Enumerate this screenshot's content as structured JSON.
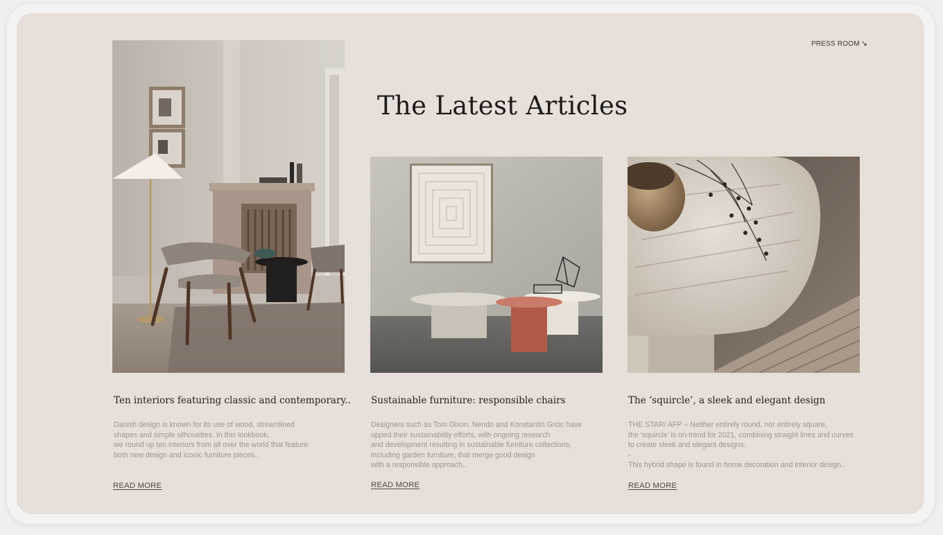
{
  "header": {
    "press_room": "PRESS ROOM",
    "press_room_icon": "arrow-down-right-icon"
  },
  "page_title": "The Latest Articles",
  "articles": [
    {
      "title": "Ten interiors featuring classic and contemporary..",
      "lines": [
        "Danish design is known for its use of wood, streamlined",
        "shapes and simple silhouettes. In this lookbook,",
        "we round up ten interiors from all over the world that feature",
        "both new design and iconic furniture pieces.."
      ],
      "read_more": "READ MORE"
    },
    {
      "title": "Sustainable furniture:  responsible chairs",
      "lines": [
        "Designers such as Tom Dixon, Nendo and Konstantin Grcic have",
        "upped their sustainability efforts, with ongoing research",
        "and development resulting in sustainable furniture collections,",
        "including garden furniture, that merge good design",
        "with a responsible approach.."
      ],
      "read_more": "READ MORE"
    },
    {
      "title": "The ‘squircle’, a sleek and elegant design",
      "lines": [
        "THE STAR/ AFP – Neither entirely round, nor entirely square,",
        "the ‘squircle’ is on-trend for 2021, combining straight lines and curves",
        "to create sleek and elegant designs.",
        "-",
        "This hybrid shape is found in home decoration and interior design.."
      ],
      "read_more": "READ MORE"
    }
  ],
  "colors": {
    "card_bg": "#e7dfda",
    "title": "#1d1a18",
    "body_text": "#9d9591",
    "link": "#4d4744"
  }
}
